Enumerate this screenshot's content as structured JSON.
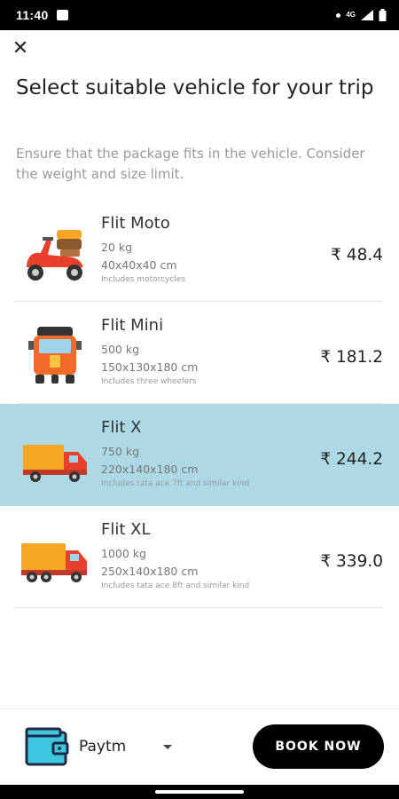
{
  "status_bar": {
    "time": "11:40",
    "network": "4G"
  },
  "close_icon": "close-icon",
  "title": "Select suitable vehicle for your trip",
  "subtitle": "Ensure that the package fits in the vehicle. Consider the weight and size limit.",
  "vehicles": [
    {
      "name": "Flit Moto",
      "weight": "20 kg",
      "size": "40x40x40 cm",
      "note": "Includes motorcycles",
      "price": "₹ 48.4",
      "icon": "scooter-icon",
      "selected": false
    },
    {
      "name": "Flit Mini",
      "weight": "500 kg",
      "size": "150x130x180 cm",
      "note": "Includes three wheelers",
      "price": "₹ 181.2",
      "icon": "auto-rickshaw-icon",
      "selected": false
    },
    {
      "name": "Flit X",
      "weight": "750 kg",
      "size": "220x140x180 cm",
      "note": "Includes tata ace 7ft and similar kind",
      "price": "₹ 244.2",
      "icon": "small-truck-icon",
      "selected": true
    },
    {
      "name": "Flit XL",
      "weight": "1000 kg",
      "size": "250x140x180 cm",
      "note": "Includes tata ace 8ft and similar kind",
      "price": "₹ 339.0",
      "icon": "large-truck-icon",
      "selected": false
    }
  ],
  "payment": {
    "label": "Paytm",
    "icon": "wallet-icon"
  },
  "book_button": "BOOK NOW",
  "colors": {
    "selected_row": "#add8e6",
    "button_bg": "#000000",
    "button_text": "#ffffff"
  }
}
